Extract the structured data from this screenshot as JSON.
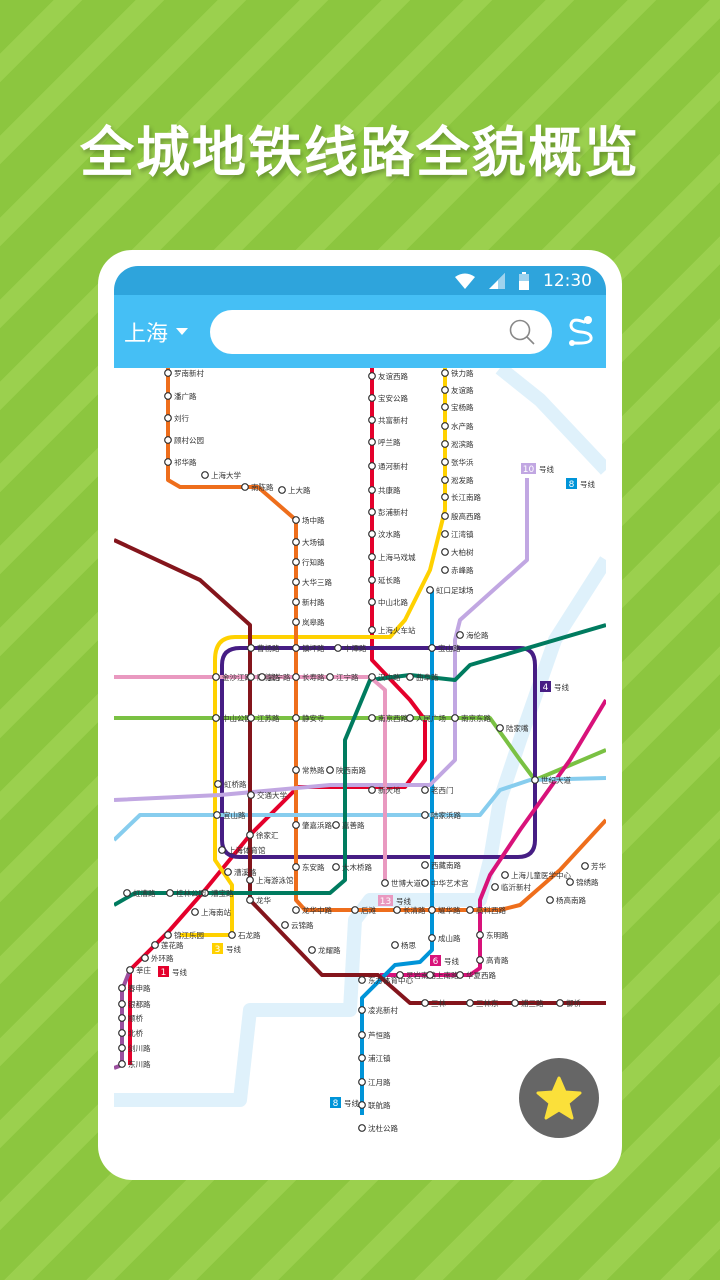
{
  "headline": "全城地铁线路全貌概览",
  "status_bar": {
    "time": "12:30",
    "icons": [
      "wifi-icon",
      "signal-icon",
      "battery-icon"
    ]
  },
  "app_bar": {
    "city": "上海",
    "search_placeholder": "",
    "search_icon": "search-icon",
    "route_icon": "route-icon"
  },
  "colors": {
    "background": "#8cc63f",
    "status_bar": "#2ea4dc",
    "app_bar": "#45bff5",
    "fav_button": "#666666",
    "star": "#fbe03a"
  },
  "map": {
    "lines": [
      {
        "id": "1",
        "color": "#e4002b"
      },
      {
        "id": "2",
        "color": "#7ac143"
      },
      {
        "id": "3",
        "color": "#ffd100"
      },
      {
        "id": "4",
        "color": "#461d84"
      },
      {
        "id": "5",
        "color": "#9b4f9f"
      },
      {
        "id": "6",
        "color": "#d8127a"
      },
      {
        "id": "7",
        "color": "#ee6e1c"
      },
      {
        "id": "8",
        "color": "#0094d8"
      },
      {
        "id": "9",
        "color": "#87cdee"
      },
      {
        "id": "10",
        "color": "#c1a7e2"
      },
      {
        "id": "11",
        "color": "#84151c"
      },
      {
        "id": "12",
        "color": "#007b5f"
      },
      {
        "id": "13",
        "color": "#e999c0"
      }
    ],
    "line_badges": [
      {
        "num": "10",
        "suffix": "号线",
        "color": "#c1a7e2"
      },
      {
        "num": "8",
        "suffix": "号线",
        "color": "#0094d8"
      },
      {
        "num": "4",
        "suffix": "号线",
        "color": "#461d84"
      },
      {
        "num": "13",
        "suffix": "号线",
        "color": "#e999c0"
      },
      {
        "num": "3",
        "suffix": "号线",
        "color": "#ffd100"
      },
      {
        "num": "1",
        "suffix": "号线",
        "color": "#e4002b"
      },
      {
        "num": "6",
        "suffix": "号线",
        "color": "#d8127a"
      },
      {
        "num": "8",
        "suffix": "号线",
        "color": "#0094d8"
      }
    ],
    "stations": [
      "罗南新村",
      "潘广路",
      "刘行",
      "顾村公园",
      "祁华路",
      "上海大学",
      "南陈路",
      "上大路",
      "场中路",
      "大场镇",
      "行知路",
      "大华三路",
      "新村路",
      "岚皋路",
      "友谊西路",
      "宝安公路",
      "共富新村",
      "呼兰路",
      "通河新村",
      "共康路",
      "彭浦新村",
      "汶水路",
      "上海马戏城",
      "延长路",
      "中山北路",
      "上海火车站",
      "铁力路",
      "友谊路",
      "宝杨路",
      "水产路",
      "淞滨路",
      "张华浜",
      "淞发路",
      "长江南路",
      "殷高西路",
      "江湾镇",
      "大柏树",
      "赤峰路",
      "虹口足球场",
      "曹杨路",
      "镇坪路",
      "中潭路",
      "宝山路",
      "海伦路",
      "金沙江路",
      "隆德路",
      "武宁路",
      "长寿路",
      "江宁路",
      "汉中路",
      "曲阜路",
      "中山公园",
      "江苏路",
      "静安寺",
      "南京西路",
      "人民广场",
      "南京东路",
      "陆家嘴",
      "世纪大道",
      "常熟路",
      "陕西南路",
      "新天地",
      "老西门",
      "虹桥路",
      "交通大学",
      "宜山路",
      "徐家汇",
      "肇嘉浜路",
      "嘉善路",
      "陆家浜路",
      "上海体育馆",
      "东安路",
      "大木桥路",
      "西藏南路",
      "龙华中路",
      "龙华",
      "漕宝路",
      "上海南站",
      "石龙路",
      "莘庄",
      "东方体育中心",
      "凌兆新村",
      "芦恒路",
      "浦江镇",
      "江月路",
      "联航路",
      "沈杜公路",
      "三林",
      "三林东",
      "浦三路",
      "御桥",
      "高青路",
      "东明路",
      "成山路",
      "耀华路",
      "长清路",
      "后滩",
      "云锦路",
      "龙耀路",
      "中华艺术宫",
      "世博大道",
      "锦江乐园",
      "莲花路",
      "外环路",
      "春申路",
      "银都路",
      "颛桥",
      "北桥",
      "剑川路",
      "东川路",
      "虹漕路",
      "桂林公园",
      "漕溪路",
      "上海游泳馆",
      "杨高南路",
      "芳华路",
      "锦绣路",
      "上海儿童医学中心",
      "临沂新村",
      "高科西路",
      "灵岩南路",
      "上南路",
      "华夏西路",
      "杨思"
    ]
  },
  "fav_button": {
    "icon": "star-icon"
  }
}
